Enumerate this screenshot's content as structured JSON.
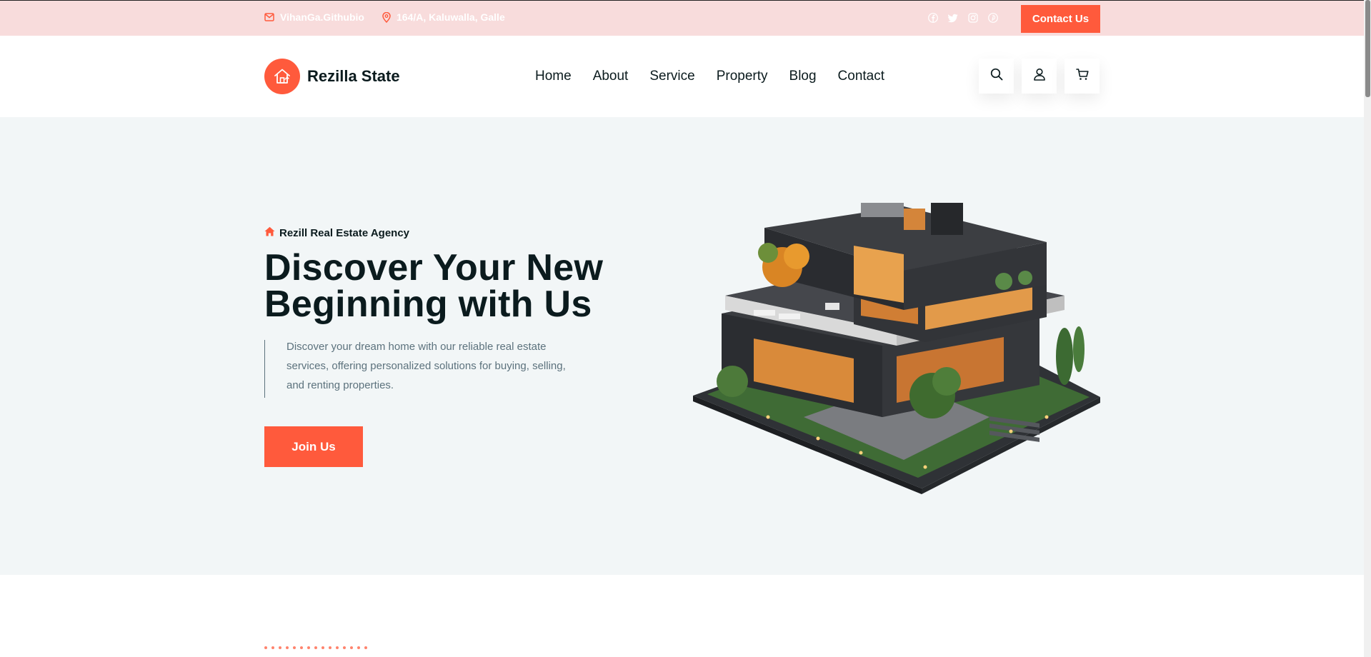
{
  "topbar": {
    "email": "VihanGa.Githubio",
    "address": "164/A, Kaluwalla, Galle",
    "socials": [
      "facebook-icon",
      "twitter-icon",
      "instagram-icon",
      "pinterest-icon"
    ],
    "contact_button": "Contact Us"
  },
  "header": {
    "logo_text": "Rezilla State",
    "nav": [
      "Home",
      "About",
      "Service",
      "Property",
      "Blog",
      "Contact"
    ],
    "icons": [
      "search-icon",
      "user-icon",
      "cart-icon"
    ]
  },
  "hero": {
    "eyebrow": "Rezill Real Estate Agency",
    "title": "Discover Your New Beginning with Us",
    "description": "Discover your dream home with our reliable real estate services, offering personalized solutions for buying, selling, and renting properties.",
    "cta": "Join Us"
  },
  "colors": {
    "accent": "#ff5a3c",
    "topbar_bg": "#f8dcdc",
    "hero_bg": "#f2f6f7",
    "heading": "#0b1b1e",
    "body_text": "#5c727d"
  }
}
